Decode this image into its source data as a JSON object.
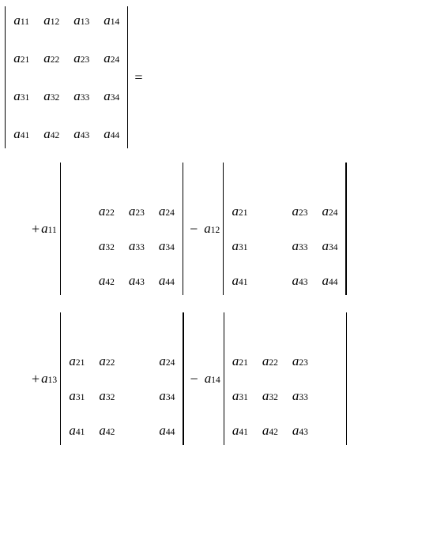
{
  "main": {
    "m11": "11",
    "m12": "12",
    "m13": "13",
    "m14": "14",
    "m21": "21",
    "m22": "22",
    "m23": "23",
    "m24": "24",
    "m31": "31",
    "m32": "32",
    "m33": "33",
    "m34": "34",
    "m41": "41",
    "m42": "42",
    "m43": "43",
    "m44": "44"
  },
  "coef": {
    "c11": "11",
    "c12": "12",
    "c13": "13",
    "c14": "14"
  },
  "minor11": {
    "r2c2": "22",
    "r2c3": "23",
    "r2c4": "24",
    "r3c2": "32",
    "r3c3": "33",
    "r3c4": "34",
    "r4c2": "42",
    "r4c3": "43",
    "r4c4": "44"
  },
  "minor12": {
    "r2c1": "21",
    "r2c3": "23",
    "r2c4": "24",
    "r3c1": "31",
    "r3c3": "33",
    "r3c4": "34",
    "r4c1": "41",
    "r4c3": "43",
    "r4c4": "44"
  },
  "minor13": {
    "r2c1": "21",
    "r2c2": "22",
    "r2c4": "24",
    "r3c1": "31",
    "r3c2": "32",
    "r3c4": "34",
    "r4c1": "41",
    "r4c2": "42",
    "r4c4": "44"
  },
  "minor14": {
    "r2c1": "21",
    "r2c2": "22",
    "r2c3": "23",
    "r3c1": "31",
    "r3c2": "32",
    "r3c3": "33",
    "r4c1": "41",
    "r4c2": "42",
    "r4c3": "43"
  },
  "sym": {
    "a": "a",
    "eq": "=",
    "plus": "+",
    "minus": "−"
  }
}
